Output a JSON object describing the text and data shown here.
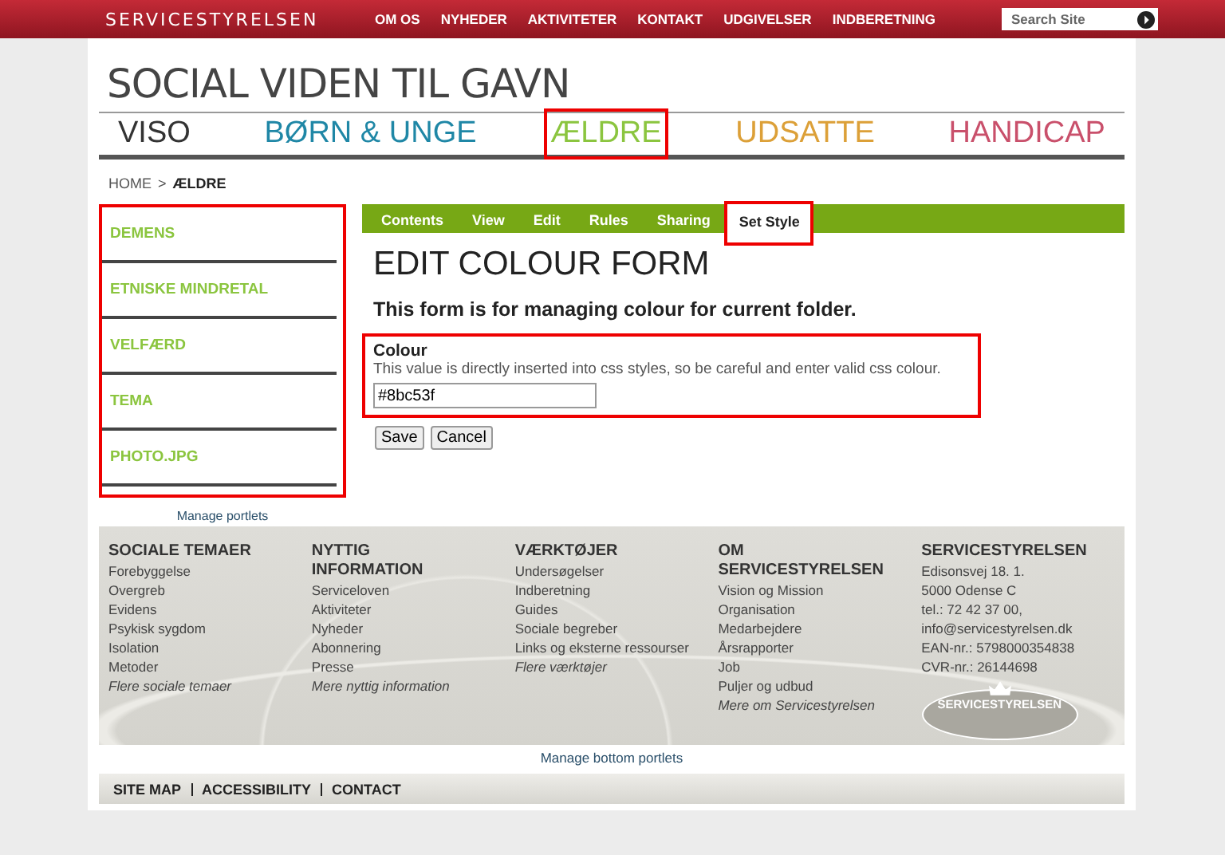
{
  "top_bar": {
    "logo": "SERVICESTYRELSEN",
    "menu": [
      "OM OS",
      "NYHEDER",
      "AKTIVITETER",
      "KONTAKT",
      "UDGIVELSER",
      "INDBERETNING"
    ],
    "search": {
      "placeholder": "Search Site"
    }
  },
  "site_title": "SOCIAL VIDEN TIL GAVN",
  "sections": [
    {
      "label": "VISO",
      "color": "#333333",
      "highlighted": false
    },
    {
      "label": "BØRN & UNGE",
      "color": "#1f87a6",
      "highlighted": false
    },
    {
      "label": "ÆLDRE",
      "color": "#8bc53f",
      "highlighted": true
    },
    {
      "label": "UDSATTE",
      "color": "#dca038",
      "highlighted": false
    },
    {
      "label": "HANDICAP",
      "color": "#c9506b",
      "highlighted": false
    }
  ],
  "breadcrumb": {
    "home": "HOME",
    "separator": ">",
    "current": "ÆLDRE"
  },
  "sidebar": {
    "highlighted": true,
    "items": [
      "DEMENS",
      "ETNISKE MINDRETAL",
      "VELFÆRD",
      "TEMA",
      "PHOTO.JPG"
    ],
    "manage": "Manage portlets"
  },
  "tabs": [
    {
      "label": "Contents",
      "selected": false,
      "highlighted": false
    },
    {
      "label": "View",
      "selected": false,
      "highlighted": false
    },
    {
      "label": "Edit",
      "selected": false,
      "highlighted": false
    },
    {
      "label": "Rules",
      "selected": false,
      "highlighted": false
    },
    {
      "label": "Sharing",
      "selected": false,
      "highlighted": false
    },
    {
      "label": "Set Style",
      "selected": true,
      "highlighted": true
    }
  ],
  "form": {
    "heading": "EDIT COLOUR FORM",
    "description": "This form is for managing colour for current folder.",
    "field": {
      "label": "Colour",
      "help": "This value is directly inserted into css styles, so be careful and enter valid css colour.",
      "value": "#8bc53f",
      "highlighted": true
    },
    "buttons": [
      "Save",
      "Cancel"
    ]
  },
  "footer": {
    "columns": [
      {
        "heading": "SOCIALE TEMAER",
        "items": [
          {
            "text": "Forebyggelse",
            "kind": "link"
          },
          {
            "text": "Overgreb",
            "kind": "link"
          },
          {
            "text": "Evidens",
            "kind": "link"
          },
          {
            "text": "Psykisk sygdom",
            "kind": "link"
          },
          {
            "text": "Isolation",
            "kind": "link"
          },
          {
            "text": "Metoder",
            "kind": "link"
          },
          {
            "text": "Flere sociale temaer",
            "kind": "more"
          }
        ]
      },
      {
        "heading": "NYTTIG INFORMATION",
        "items": [
          {
            "text": "Serviceloven",
            "kind": "link"
          },
          {
            "text": "Aktiviteter",
            "kind": "link"
          },
          {
            "text": "Nyheder",
            "kind": "link"
          },
          {
            "text": "Abonnering",
            "kind": "link"
          },
          {
            "text": "Presse",
            "kind": "link"
          },
          {
            "text": "Mere nyttig information",
            "kind": "more"
          }
        ]
      },
      {
        "heading": "VÆRKTØJER",
        "items": [
          {
            "text": "Undersøgelser",
            "kind": "link"
          },
          {
            "text": "Indberetning",
            "kind": "link"
          },
          {
            "text": "Guides",
            "kind": "link"
          },
          {
            "text": "Sociale begreber",
            "kind": "link"
          },
          {
            "text": "Links og eksterne ressourser",
            "kind": "link"
          },
          {
            "text": "Flere værktøjer",
            "kind": "more"
          }
        ]
      },
      {
        "heading": "OM SERVICESTYRELSEN",
        "items": [
          {
            "text": "Vision og Mission",
            "kind": "link"
          },
          {
            "text": "Organisation",
            "kind": "link"
          },
          {
            "text": "Medarbejdere",
            "kind": "link"
          },
          {
            "text": "Årsrapporter",
            "kind": "link"
          },
          {
            "text": "Job",
            "kind": "link"
          },
          {
            "text": "Puljer og udbud",
            "kind": "link"
          },
          {
            "text": "Mere om Servicestyrelsen",
            "kind": "more"
          }
        ]
      },
      {
        "heading": "SERVICESTYRELSEN",
        "items": [
          {
            "text": "Edisonsvej 18. 1.",
            "kind": "text"
          },
          {
            "text": "5000 Odense C",
            "kind": "text"
          },
          {
            "text": "tel.: 72 42 37 00,",
            "kind": "text"
          },
          {
            "text": "info@servicestyrelsen.dk",
            "kind": "text"
          },
          {
            "text": "EAN-nr.: 5798000354838",
            "kind": "text"
          },
          {
            "text": "CVR-nr.: 26144698",
            "kind": "text"
          }
        ],
        "logo": "SERVICESTYRELSEN"
      }
    ],
    "manage": "Manage bottom portlets"
  },
  "bottom_links": [
    "SITE MAP",
    "ACCESSIBILITY",
    "CONTACT"
  ]
}
